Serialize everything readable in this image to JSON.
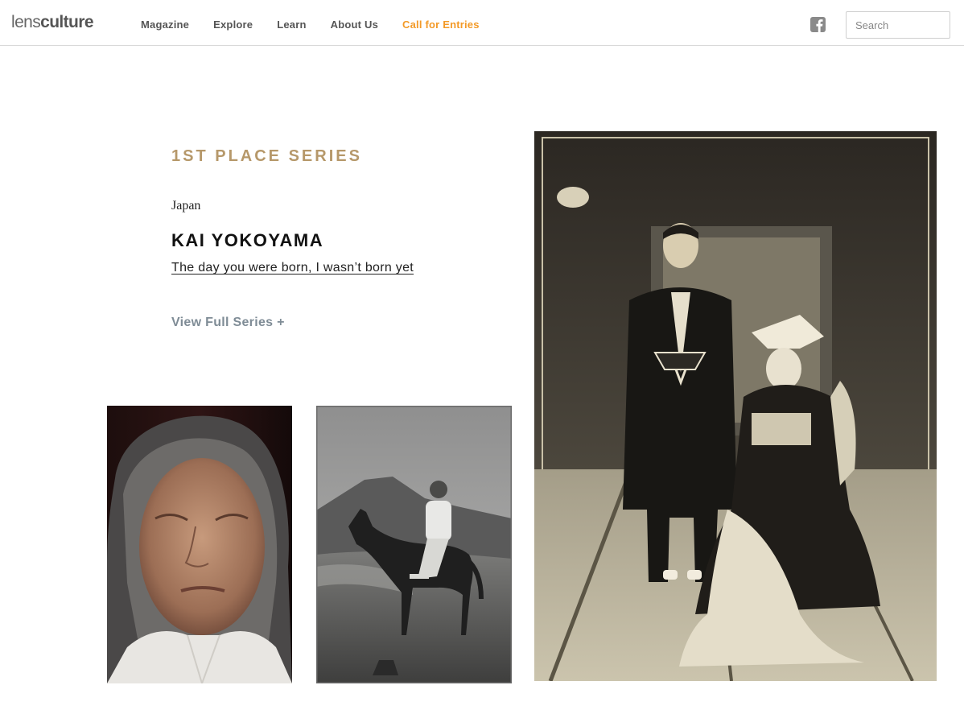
{
  "header": {
    "logo": {
      "part1": "lens",
      "part2": "culture"
    },
    "nav": [
      {
        "label": "Magazine"
      },
      {
        "label": "Explore"
      },
      {
        "label": "Learn"
      },
      {
        "label": "About Us"
      },
      {
        "label": "Call for Entries"
      }
    ],
    "facebook_icon": "facebook-icon",
    "search": {
      "placeholder": "Search",
      "value": ""
    }
  },
  "series": {
    "eyebrow": "1ST PLACE SERIES",
    "country": "Japan",
    "artist": "KAI YOKOYAMA",
    "title": "The day you were born, I wasn’t born yet",
    "view_full": "View Full Series +"
  },
  "photos": [
    {
      "subject": "elderly-woman-portrait"
    },
    {
      "subject": "man-on-horse-vintage"
    },
    {
      "subject": "wedding-couple-vintage"
    }
  ],
  "colors": {
    "accent": "#f39a27",
    "eyebrow": "#b6986a",
    "link_muted": "#7f8c96"
  }
}
